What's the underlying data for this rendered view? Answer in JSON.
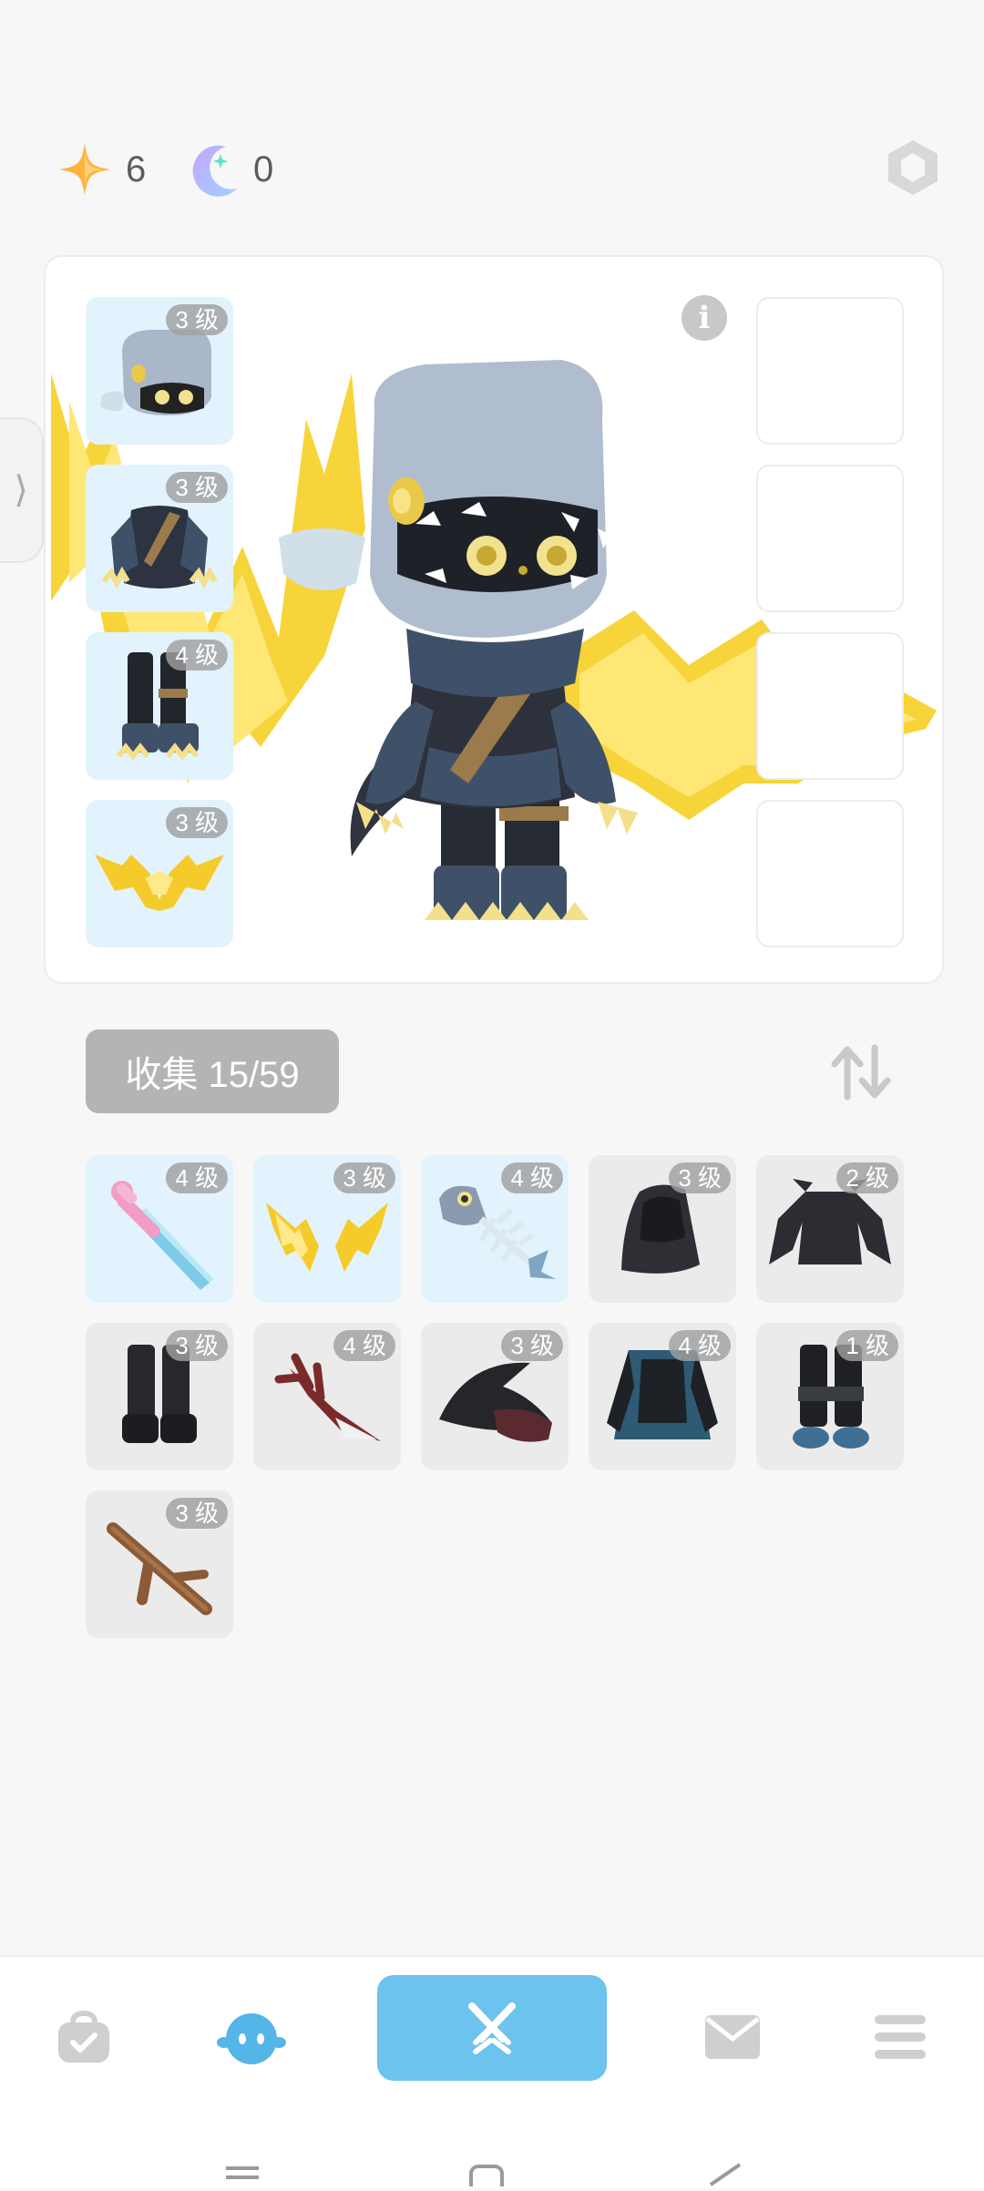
{
  "currency": {
    "star": {
      "icon": "star-icon",
      "value": "6"
    },
    "moon": {
      "icon": "moon-icon",
      "value": "0"
    }
  },
  "equipped": [
    {
      "slot": "head",
      "level": "3 级",
      "icon": "fish-hood-icon"
    },
    {
      "slot": "body",
      "level": "3 级",
      "icon": "ninja-outfit-icon"
    },
    {
      "slot": "legs",
      "level": "4 级",
      "icon": "claw-boots-icon"
    },
    {
      "slot": "back",
      "level": "3 级",
      "icon": "lightning-wings-icon"
    }
  ],
  "collection": {
    "label": "收集 15/59",
    "items": [
      {
        "level": "4 级",
        "icon": "crystal-sword-icon",
        "bg": "blue"
      },
      {
        "level": "3 级",
        "icon": "lightning-horns-icon",
        "bg": "blue"
      },
      {
        "level": "4 级",
        "icon": "fish-skeleton-icon",
        "bg": "blue"
      },
      {
        "level": "3 级",
        "icon": "dark-hood-icon",
        "bg": "grey"
      },
      {
        "level": "2 级",
        "icon": "dark-armor-icon",
        "bg": "grey"
      },
      {
        "level": "3 级",
        "icon": "black-boots-icon",
        "bg": "grey"
      },
      {
        "level": "4 级",
        "icon": "antler-blade-icon",
        "bg": "grey"
      },
      {
        "level": "3 级",
        "icon": "witch-hat-icon",
        "bg": "grey"
      },
      {
        "level": "4 级",
        "icon": "teal-cloak-icon",
        "bg": "grey"
      },
      {
        "level": "1 级",
        "icon": "blue-boots-icon",
        "bg": "grey"
      },
      {
        "level": "3 级",
        "icon": "wooden-stick-icon",
        "bg": "grey"
      }
    ]
  },
  "info_symbol": "i",
  "side_tab_symbol": "⟩",
  "nav": [
    {
      "icon": "bag-icon",
      "active": false
    },
    {
      "icon": "character-icon",
      "active": true
    },
    {
      "icon": "battle-icon",
      "active": false
    },
    {
      "icon": "mail-icon",
      "active": false
    },
    {
      "icon": "menu-icon",
      "active": false
    }
  ],
  "colors": {
    "accent": "#6cc3ee",
    "level_badge": "#a0a0a0",
    "item_blue_bg": "#e2f3fd",
    "item_grey_bg": "#ebebeb"
  }
}
